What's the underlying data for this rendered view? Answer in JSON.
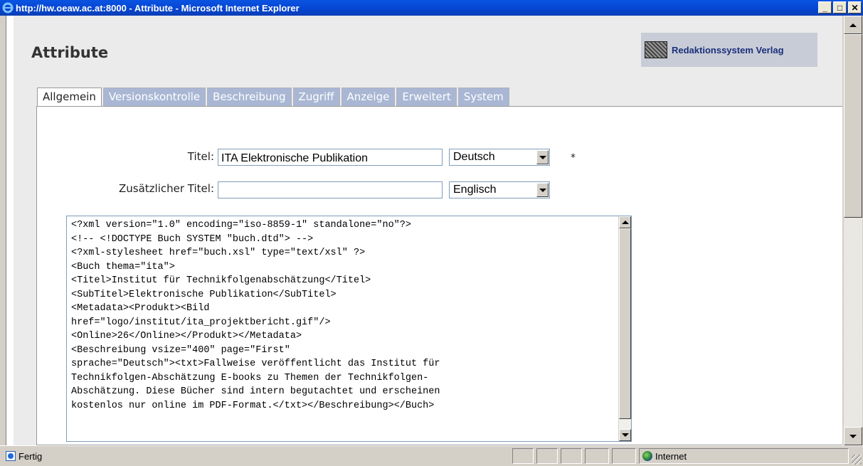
{
  "window": {
    "title": "http://hw.oeaw.ac.at:8000 - Attribute - Microsoft Internet Explorer",
    "minimize": "_",
    "maximize": "□",
    "close": "✕"
  },
  "page": {
    "title": "Attribute",
    "logo_text": "Redaktionssystem Verlag"
  },
  "tabs": [
    {
      "label": "Allgemein",
      "active": true
    },
    {
      "label": "Versionskontrolle",
      "active": false
    },
    {
      "label": "Beschreibung",
      "active": false
    },
    {
      "label": "Zugriff",
      "active": false
    },
    {
      "label": "Anzeige",
      "active": false
    },
    {
      "label": "Erweitert",
      "active": false
    },
    {
      "label": "System",
      "active": false
    }
  ],
  "form": {
    "title_label": "Titel:",
    "title_value": "ITA Elektronische Publikation",
    "title_language": "Deutsch",
    "required_marker": "*",
    "subtitle_label": "Zusätzlicher Titel:",
    "subtitle_value": "",
    "subtitle_language": "Englisch",
    "xml_content": "<?xml version=\"1.0\" encoding=\"iso-8859-1\" standalone=\"no\"?>\n<!-- <!DOCTYPE Buch SYSTEM \"buch.dtd\"> -->\n<?xml-stylesheet href=\"buch.xsl\" type=\"text/xsl\" ?>\n<Buch thema=\"ita\">\n<Titel>Institut für Technikfolgenabschätzung</Titel>\n<SubTitel>Elektronische Publikation</SubTitel>\n<Metadata><Produkt><Bild\nhref=\"logo/institut/ita_projektbericht.gif\"/>\n<Online>26</Online></Produkt></Metadata>\n<Beschreibung vsize=\"400\" page=\"First\"\nsprache=\"Deutsch\"><txt>Fallweise veröffentlicht das Institut für\nTechnikfolgen-Abschätzung E-books zu Themen der Technikfolgen-\nAbschätzung. Diese Bücher sind intern begutachtet und erscheinen\nkostenlos nur online im PDF-Format.</txt></Beschreibung></Buch>"
  },
  "statusbar": {
    "status": "Fertig",
    "zone": "Internet"
  },
  "icons": {
    "browser": "ie-icon",
    "status_page": "page-icon",
    "zone": "globe-icon",
    "dropdown": "chevron-down-icon"
  }
}
